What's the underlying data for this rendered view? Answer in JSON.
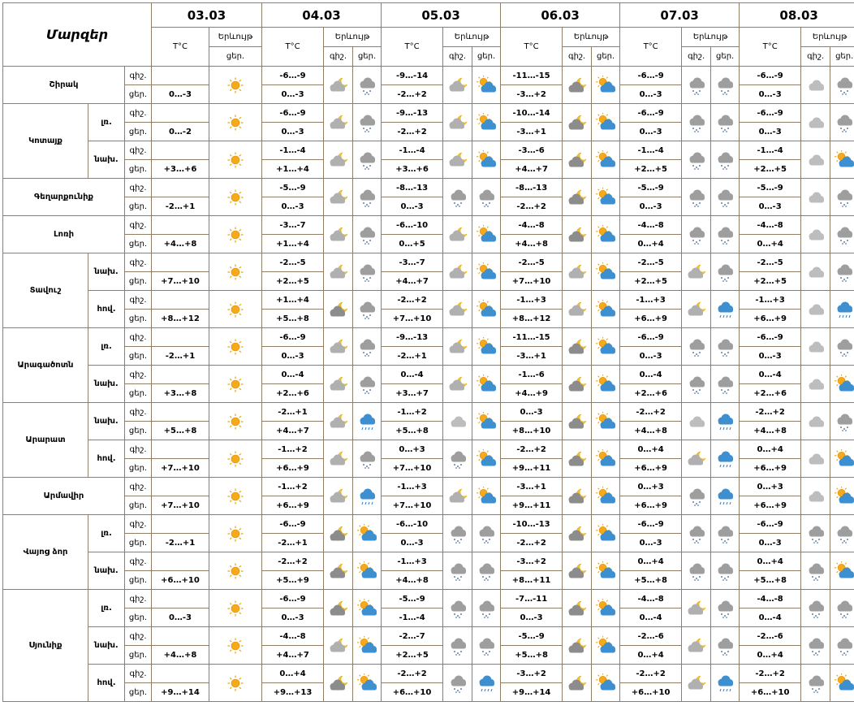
{
  "table": {
    "title": "Մարզեր",
    "temp_header": "T°C",
    "weather_header": "Երևույթ",
    "night": "գիշ.",
    "day": "ցեր.",
    "dates": [
      "03.03",
      "04.03",
      "05.03",
      "06.03",
      "07.03",
      "08.03"
    ]
  },
  "regions": [
    {
      "name": "Շիրակ",
      "subs": [
        {
          "label": "",
          "night": {
            "temps": [
              "",
              "-6…-9",
              "-9…-14",
              "-11…-15",
              "-6…-9",
              "-6…-9"
            ],
            "icons": [
              "",
              "pc-night",
              "pc-night",
              "cloud-night",
              "cloud-snow",
              "cloud-gray"
            ]
          },
          "day": {
            "temps": [
              "0…-3",
              "0…-3",
              "-2…+2",
              "-3…+2",
              "0…-3",
              "0…-3"
            ],
            "icons": [
              "sun",
              "cloud-snow",
              "sun-cloud",
              "sun-cloud",
              "cloud-snow",
              "cloud-snow"
            ]
          }
        }
      ]
    },
    {
      "name": "Կոտայք",
      "subs": [
        {
          "label": "լռ.",
          "night": {
            "temps": [
              "",
              "-6…-9",
              "-9…-13",
              "-10…-14",
              "-6…-9",
              "-6…-9"
            ],
            "icons": [
              "",
              "pc-night",
              "pc-night",
              "cloud-night",
              "cloud-snow",
              "cloud-gray"
            ]
          },
          "day": {
            "temps": [
              "0…-2",
              "0…-3",
              "-2…+2",
              "-3…+1",
              "0…-3",
              "0…-3"
            ],
            "icons": [
              "sun",
              "cloud-snow",
              "sun-cloud",
              "sun-cloud",
              "cloud-snow",
              "cloud-snow"
            ]
          }
        },
        {
          "label": "նախ.",
          "night": {
            "temps": [
              "",
              "-1…-4",
              "-1…-4",
              "-3…-6",
              "-1…-4",
              "-1…-4"
            ],
            "icons": [
              "",
              "pc-night",
              "pc-night",
              "cloud-night",
              "cloud-snow",
              "cloud-gray"
            ]
          },
          "day": {
            "temps": [
              "+3…+6",
              "+1…+4",
              "+3…+6",
              "+4…+7",
              "+2…+5",
              "+2…+5"
            ],
            "icons": [
              "sun",
              "cloud-snow",
              "sun-cloud",
              "sun-cloud",
              "cloud-snow",
              "sun-cloud"
            ]
          }
        }
      ]
    },
    {
      "name": "Գեղարքունիք",
      "subs": [
        {
          "label": "",
          "night": {
            "temps": [
              "",
              "-5…-9",
              "-8…-13",
              "-8…-13",
              "-5…-9",
              "-5…-9"
            ],
            "icons": [
              "",
              "pc-night",
              "cloud-snow",
              "cloud-night",
              "cloud-snow",
              "cloud-gray"
            ]
          },
          "day": {
            "temps": [
              "-2…+1",
              "0…-3",
              "0…-3",
              "-2…+2",
              "0…-3",
              "0…-3"
            ],
            "icons": [
              "sun",
              "cloud-snow",
              "cloud-snow",
              "sun-cloud",
              "cloud-snow",
              "cloud-snow"
            ]
          }
        }
      ]
    },
    {
      "name": "Լոռի",
      "subs": [
        {
          "label": "",
          "night": {
            "temps": [
              "",
              "-3…-7",
              "-6…-10",
              "-4…-8",
              "-4…-8",
              "-4…-8"
            ],
            "icons": [
              "",
              "pc-night",
              "pc-night",
              "cloud-night",
              "cloud-snow",
              "cloud-gray"
            ]
          },
          "day": {
            "temps": [
              "+4…+8",
              "+1…+4",
              "0…+5",
              "+4…+8",
              "0…+4",
              "0…+4"
            ],
            "icons": [
              "sun",
              "cloud-snow",
              "sun-cloud",
              "sun-cloud",
              "cloud-snow",
              "cloud-snow"
            ]
          }
        }
      ]
    },
    {
      "name": "Տավուշ",
      "subs": [
        {
          "label": "նախ.",
          "night": {
            "temps": [
              "",
              "-2…-5",
              "-3…-7",
              "-2…-5",
              "-2…-5",
              "-2…-5"
            ],
            "icons": [
              "",
              "pc-night",
              "pc-night",
              "pc-night",
              "pc-night",
              "cloud-gray"
            ]
          },
          "day": {
            "temps": [
              "+7…+10",
              "+2…+5",
              "+4…+7",
              "+7…+10",
              "+2…+5",
              "+2…+5"
            ],
            "icons": [
              "sun",
              "cloud-snow",
              "sun-cloud",
              "sun-cloud",
              "cloud-snow",
              "cloud-snow"
            ]
          }
        },
        {
          "label": "հով.",
          "night": {
            "temps": [
              "",
              "+1…+4",
              "-2…+2",
              "-1…+3",
              "-1…+3",
              "-1…+3"
            ],
            "icons": [
              "",
              "cloud-night",
              "pc-night",
              "pc-night",
              "pc-night",
              "cloud-gray"
            ]
          },
          "day": {
            "temps": [
              "+8…+12",
              "+5…+8",
              "+7…+10",
              "+8…+12",
              "+6…+9",
              "+6…+9"
            ],
            "icons": [
              "sun",
              "cloud-snow",
              "sun-cloud",
              "sun-cloud",
              "cloud-rain",
              "cloud-rain"
            ]
          }
        }
      ]
    },
    {
      "name": "Արագածոտն",
      "subs": [
        {
          "label": "լռ.",
          "night": {
            "temps": [
              "",
              "-6…-9",
              "-9…-13",
              "-11…-15",
              "-6…-9",
              "-6…-9"
            ],
            "icons": [
              "",
              "pc-night",
              "pc-night",
              "cloud-night",
              "cloud-snow",
              "cloud-gray"
            ]
          },
          "day": {
            "temps": [
              "-2…+1",
              "0…-3",
              "-2…+1",
              "-3…+1",
              "0…-3",
              "0…-3"
            ],
            "icons": [
              "sun",
              "cloud-snow",
              "sun-cloud",
              "sun-cloud",
              "cloud-snow",
              "cloud-snow"
            ]
          }
        },
        {
          "label": "նախ.",
          "night": {
            "temps": [
              "",
              "0…-4",
              "0…-4",
              "-1…-6",
              "0…-4",
              "0…-4"
            ],
            "icons": [
              "",
              "pc-night",
              "pc-night",
              "cloud-night",
              "cloud-snow",
              "cloud-gray"
            ]
          },
          "day": {
            "temps": [
              "+3…+8",
              "+2…+6",
              "+3…+7",
              "+4…+9",
              "+2…+6",
              "+2…+6"
            ],
            "icons": [
              "sun",
              "cloud-snow",
              "sun-cloud",
              "sun-cloud",
              "cloud-snow",
              "sun-cloud"
            ]
          }
        }
      ]
    },
    {
      "name": "Արարատ",
      "subs": [
        {
          "label": "նախ.",
          "night": {
            "temps": [
              "",
              "-2…+1",
              "-1…+2",
              "0…-3",
              "-2…+2",
              "-2…+2"
            ],
            "icons": [
              "",
              "pc-night",
              "cloud-gray",
              "cloud-night",
              "cloud-gray",
              "cloud-gray"
            ]
          },
          "day": {
            "temps": [
              "+5…+8",
              "+4…+7",
              "+5…+8",
              "+8…+10",
              "+4…+8",
              "+4…+8"
            ],
            "icons": [
              "sun",
              "cloud-rain",
              "sun-cloud",
              "sun-cloud",
              "cloud-rain",
              "cloud-snow"
            ]
          }
        },
        {
          "label": "հով.",
          "night": {
            "temps": [
              "",
              "-1…+2",
              "0…+3",
              "-2…+2",
              "0…+4",
              "0…+4"
            ],
            "icons": [
              "",
              "pc-night",
              "cloud-snow",
              "cloud-night",
              "pc-night",
              "cloud-gray"
            ]
          },
          "day": {
            "temps": [
              "+7…+10",
              "+6…+9",
              "+7…+10",
              "+9…+11",
              "+6…+9",
              "+6…+9"
            ],
            "icons": [
              "sun",
              "cloud-snow",
              "sun-cloud",
              "sun-cloud",
              "cloud-rain",
              "sun-cloud"
            ]
          }
        }
      ]
    },
    {
      "name": "Արմավիր",
      "subs": [
        {
          "label": "",
          "night": {
            "temps": [
              "",
              "-1…+2",
              "-1…+3",
              "-3…+1",
              "0…+3",
              "0…+3"
            ],
            "icons": [
              "",
              "pc-night",
              "pc-night",
              "cloud-night",
              "cloud-snow",
              "cloud-gray"
            ]
          },
          "day": {
            "temps": [
              "+7…+10",
              "+6…+9",
              "+7…+10",
              "+9…+11",
              "+6…+9",
              "+6…+9"
            ],
            "icons": [
              "sun",
              "cloud-rain",
              "sun-cloud",
              "sun-cloud",
              "cloud-rain",
              "sun-cloud"
            ]
          }
        }
      ]
    },
    {
      "name": "Վայոց ձոր",
      "subs": [
        {
          "label": "լռ.",
          "night": {
            "temps": [
              "",
              "-6…-9",
              "-6…-10",
              "-10…-13",
              "-6…-9",
              "-6…-9"
            ],
            "icons": [
              "",
              "cloud-night",
              "cloud-snow",
              "cloud-night",
              "cloud-snow",
              "cloud-snow"
            ]
          },
          "day": {
            "temps": [
              "-2…+1",
              "-2…+1",
              "0…-3",
              "-2…+2",
              "0…-3",
              "0…-3"
            ],
            "icons": [
              "sun",
              "sun-cloud",
              "cloud-snow",
              "sun-cloud",
              "cloud-snow",
              "cloud-snow"
            ]
          }
        },
        {
          "label": "նախ.",
          "night": {
            "temps": [
              "",
              "-2…+2",
              "-1…+3",
              "-3…+2",
              "0…+4",
              "0…+4"
            ],
            "icons": [
              "",
              "cloud-night",
              "cloud-snow",
              "cloud-night",
              "cloud-snow",
              "cloud-snow"
            ]
          },
          "day": {
            "temps": [
              "+6…+10",
              "+5…+9",
              "+4…+8",
              "+8…+11",
              "+5…+8",
              "+5…+8"
            ],
            "icons": [
              "sun",
              "sun-cloud",
              "cloud-snow",
              "sun-cloud",
              "cloud-snow",
              "sun-cloud"
            ]
          }
        }
      ]
    },
    {
      "name": "Սյունիք",
      "subs": [
        {
          "label": "լռ.",
          "night": {
            "temps": [
              "",
              "-6…-9",
              "-5…-9",
              "-7…-11",
              "-4…-8",
              "-4…-8"
            ],
            "icons": [
              "",
              "cloud-night",
              "cloud-snow",
              "cloud-night",
              "pc-night",
              "cloud-snow"
            ]
          },
          "day": {
            "temps": [
              "0…-3",
              "0…-3",
              "-1…-4",
              "0…-3",
              "0…-4",
              "0…-4"
            ],
            "icons": [
              "sun",
              "sun-cloud",
              "cloud-snow",
              "sun-cloud",
              "cloud-snow",
              "cloud-snow"
            ]
          }
        },
        {
          "label": "նախ.",
          "night": {
            "temps": [
              "",
              "-4…-8",
              "-2…-7",
              "-5…-9",
              "-2…-6",
              "-2…-6"
            ],
            "icons": [
              "",
              "pc-night",
              "cloud-snow",
              "cloud-night",
              "pc-night",
              "cloud-snow"
            ]
          },
          "day": {
            "temps": [
              "+4…+8",
              "+4…+7",
              "+2…+5",
              "+5…+8",
              "0…+4",
              "0…+4"
            ],
            "icons": [
              "sun",
              "sun-cloud",
              "cloud-snow",
              "sun-cloud",
              "cloud-snow",
              "cloud-snow"
            ]
          }
        },
        {
          "label": "հով.",
          "night": {
            "temps": [
              "",
              "0…+4",
              "-2…+2",
              "-3…+2",
              "-2…+2",
              "-2…+2"
            ],
            "icons": [
              "",
              "cloud-night",
              "cloud-snow",
              "cloud-night",
              "pc-night",
              "cloud-snow"
            ]
          },
          "day": {
            "temps": [
              "+9…+14",
              "+9…+13",
              "+6…+10",
              "+9…+14",
              "+6…+10",
              "+6…+10"
            ],
            "icons": [
              "sun",
              "sun-cloud",
              "cloud-rain",
              "sun-cloud",
              "cloud-rain",
              "sun-cloud"
            ]
          }
        }
      ]
    }
  ]
}
